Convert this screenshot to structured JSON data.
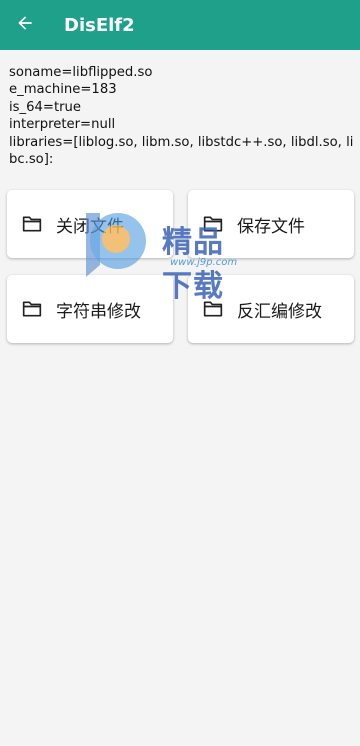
{
  "appbar": {
    "title": "DisElf2",
    "back_icon": "arrow-left-icon",
    "color": "#1ea08a"
  },
  "info": {
    "lines": [
      "soname=libflipped.so",
      "e_machine=183",
      "is_64=true",
      "interpreter=null",
      "libraries=[liblog.so, libm.so, libstdc++.so, libdl.so, libc.so]:"
    ]
  },
  "actions": [
    {
      "label": "关闭文件",
      "icon": "folder-icon"
    },
    {
      "label": "保存文件",
      "icon": "folder-icon"
    },
    {
      "label": "字符串修改",
      "icon": "folder-icon"
    },
    {
      "label": "反汇编修改",
      "icon": "folder-icon"
    }
  ],
  "watermark": {
    "text": "精品下载",
    "url": "www.j9p.com"
  }
}
